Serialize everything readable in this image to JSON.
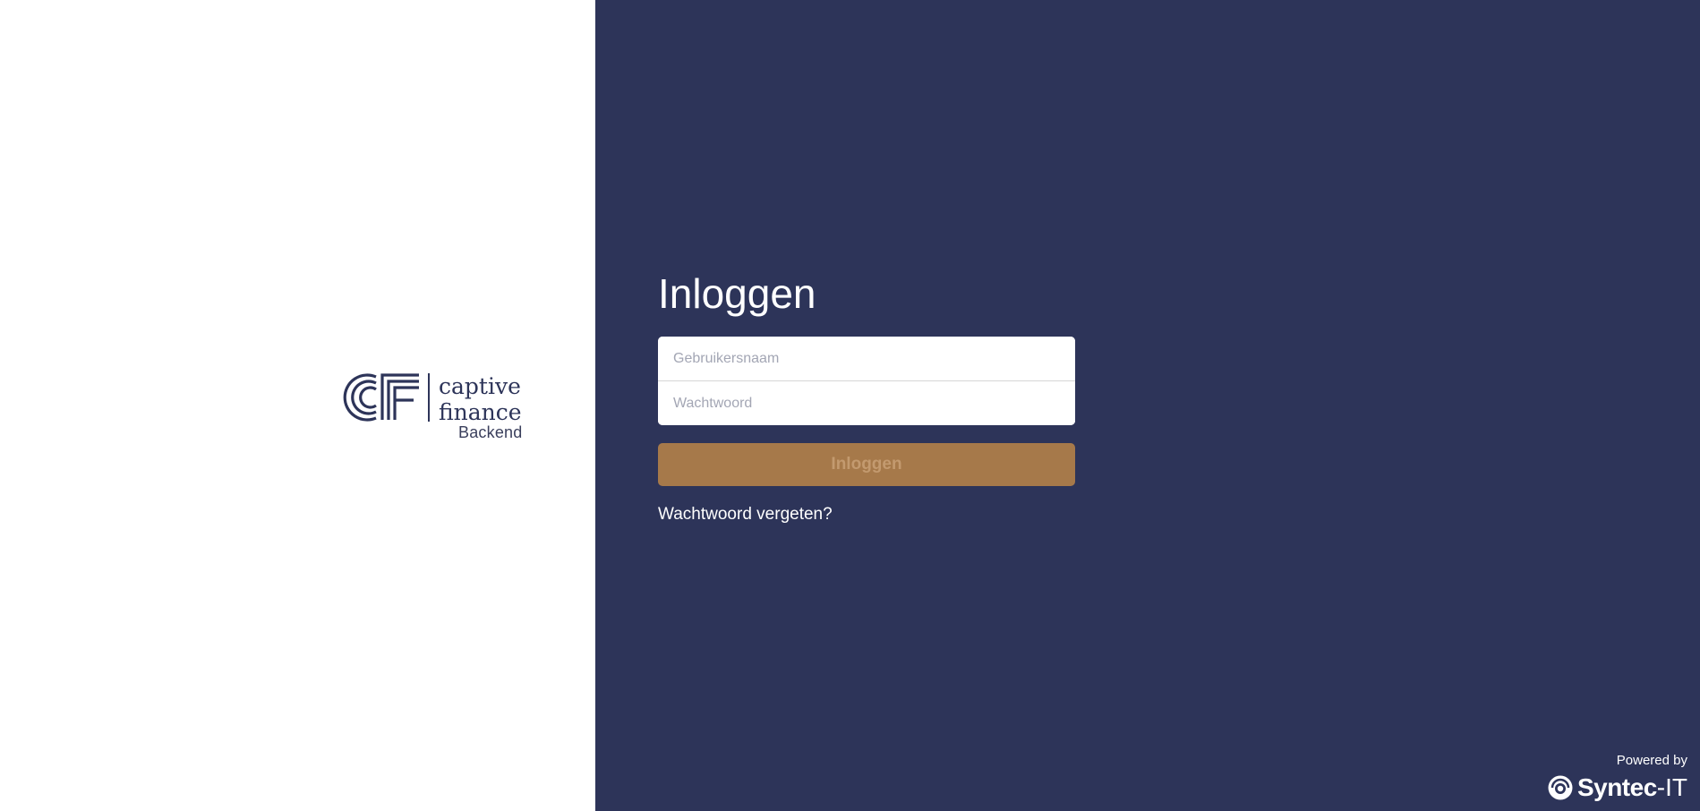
{
  "brand": {
    "logo_word_1": "captive",
    "logo_word_2": "finance",
    "logo_monogram": "CF",
    "subtitle": "Backend",
    "navy": "#2d3459",
    "accent": "#a6794a"
  },
  "login": {
    "title": "Inloggen",
    "username_placeholder": "Gebruikersnaam",
    "password_placeholder": "Wachtwoord",
    "submit_label": "Inloggen",
    "forgot_label": "Wachtwoord vergeten?"
  },
  "footer": {
    "powered_label": "Powered by",
    "vendor_name": "Syntec",
    "vendor_suffix": "-IT",
    "vendor_icon": "syntec-logo-icon"
  }
}
